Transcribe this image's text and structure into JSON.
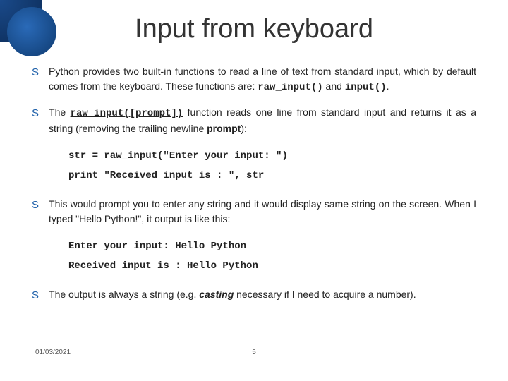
{
  "title": "Input from keyboard",
  "bullets": {
    "b1_pre": "Python provides two built-in functions to read a line of text from standard input, which by default comes from the keyboard. These functions are: ",
    "b1_c1": "raw_input()",
    "b1_mid": " and ",
    "b1_c2": "input()",
    "b1_post": ".",
    "b2_pre": "The ",
    "b2_code": "raw_input([prompt])",
    "b2_mid": " function reads one line from standard input and returns it as a string (removing the trailing newline ",
    "b2_bold": "prompt",
    "b2_post": "):",
    "b3": "This would prompt you to enter any string and it would display same string on the screen. When I typed \"Hello Python!\", it output is like this:",
    "b4_pre": "The output is always a string (e.g. ",
    "b4_bold": "casting",
    "b4_post": " necessary if I need to acquire a number)."
  },
  "code1": {
    "l1": "str = raw_input(\"Enter your input: \")",
    "l2": "print \"Received input is : \", str"
  },
  "code2": {
    "l1": "Enter your input: Hello Python",
    "l2": "Received input is : Hello Python"
  },
  "footer": {
    "date": "01/03/2021",
    "page": "5"
  },
  "marker": "S"
}
